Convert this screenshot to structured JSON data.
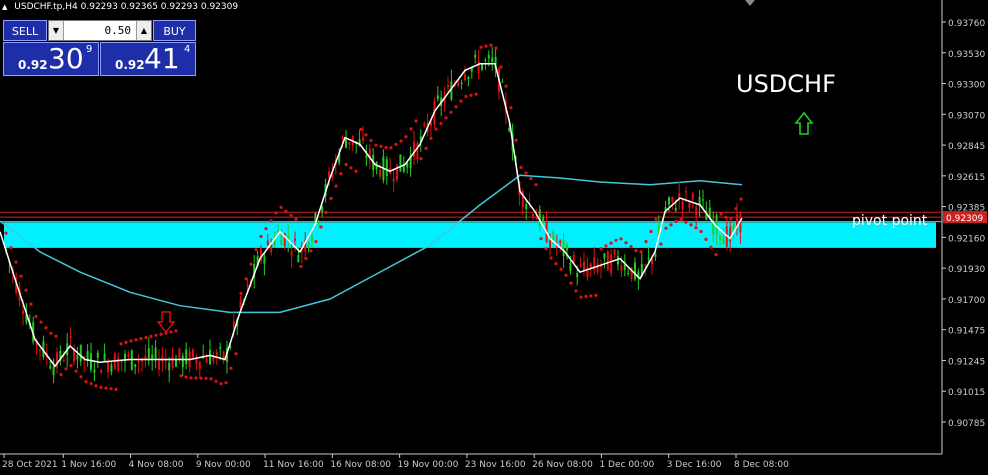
{
  "header": {
    "symbol_info": "USDCHF.tp,H4",
    "ohlc": "0.92293 0.92365 0.92293 0.92309"
  },
  "trade_panel": {
    "sell_label": "SELL",
    "buy_label": "BUY",
    "lot_value": "0.50",
    "sell_prefix": "0.92",
    "sell_big": "30",
    "sell_sup": "9",
    "buy_prefix": "0.92",
    "buy_big": "41",
    "buy_sup": "4"
  },
  "chart_title": "USDCHF",
  "pivot_label": "pivot point",
  "price_axis": [
    "0.93760",
    "0.93530",
    "0.93300",
    "0.93070",
    "0.92845",
    "0.92615",
    "0.92385",
    "0.92160",
    "0.91930",
    "0.91700",
    "0.91475",
    "0.91245",
    "0.91015",
    "0.90785"
  ],
  "current_price_label": "0.92309",
  "time_axis": [
    "28 Oct 2021",
    "1 Nov 16:00",
    "4 Nov 08:00",
    "9 Nov 00:00",
    "11 Nov 16:00",
    "16 Nov 08:00",
    "19 Nov 00:00",
    "23 Nov 16:00",
    "26 Nov 08:00",
    "1 Dec 00:00",
    "3 Dec 16:00",
    "8 Dec 08:00"
  ],
  "colors": {
    "bull": "#22cc22",
    "bear": "#dd1111",
    "sar": "#dd1111",
    "ma_fast": "#ffffff",
    "ma_slow": "#40c8d8",
    "zone": "#00f0ff",
    "axis": "#cccccc",
    "up_arrow": "#22cc22",
    "down_arrow": "#dd1111"
  },
  "icons": {
    "up_arrow": "up-arrow-icon",
    "down_arrow": "down-arrow-icon"
  },
  "chart_data": {
    "type": "candlestick",
    "symbol": "USDCHF",
    "timeframe": "H4",
    "y_range": [
      0.9075,
      0.9385
    ],
    "ma_fast_path": [
      [
        0,
        0.922
      ],
      [
        15,
        0.9185
      ],
      [
        35,
        0.914
      ],
      [
        55,
        0.912
      ],
      [
        70,
        0.9135
      ],
      [
        85,
        0.9125
      ],
      [
        100,
        0.9123
      ],
      [
        130,
        0.9125
      ],
      [
        160,
        0.9125
      ],
      [
        190,
        0.9125
      ],
      [
        210,
        0.9128
      ],
      [
        225,
        0.9125
      ],
      [
        240,
        0.916
      ],
      [
        260,
        0.92
      ],
      [
        280,
        0.922
      ],
      [
        300,
        0.9205
      ],
      [
        315,
        0.9225
      ],
      [
        330,
        0.926
      ],
      [
        345,
        0.929
      ],
      [
        360,
        0.9285
      ],
      [
        375,
        0.927
      ],
      [
        390,
        0.9265
      ],
      [
        405,
        0.927
      ],
      [
        420,
        0.9285
      ],
      [
        435,
        0.931
      ],
      [
        450,
        0.9325
      ],
      [
        465,
        0.934
      ],
      [
        480,
        0.9345
      ],
      [
        495,
        0.9345
      ],
      [
        510,
        0.93
      ],
      [
        520,
        0.925
      ],
      [
        535,
        0.9235
      ],
      [
        550,
        0.9215
      ],
      [
        565,
        0.9205
      ],
      [
        580,
        0.919
      ],
      [
        600,
        0.9195
      ],
      [
        620,
        0.92
      ],
      [
        640,
        0.9185
      ],
      [
        655,
        0.9205
      ],
      [
        665,
        0.9235
      ],
      [
        680,
        0.9245
      ],
      [
        700,
        0.924
      ],
      [
        715,
        0.9225
      ],
      [
        730,
        0.9215
      ],
      [
        742,
        0.923
      ]
    ],
    "ma_slow_path": [
      [
        0,
        0.9228
      ],
      [
        40,
        0.9205
      ],
      [
        80,
        0.919
      ],
      [
        130,
        0.9175
      ],
      [
        180,
        0.9165
      ],
      [
        230,
        0.916
      ],
      [
        280,
        0.916
      ],
      [
        330,
        0.917
      ],
      [
        380,
        0.919
      ],
      [
        430,
        0.921
      ],
      [
        480,
        0.924
      ],
      [
        520,
        0.9262
      ],
      [
        560,
        0.926
      ],
      [
        600,
        0.9257
      ],
      [
        650,
        0.9255
      ],
      [
        700,
        0.9258
      ],
      [
        742,
        0.9255
      ]
    ],
    "zone": [
      0.9208,
      0.9227
    ],
    "pivot_level": 0.92309
  }
}
